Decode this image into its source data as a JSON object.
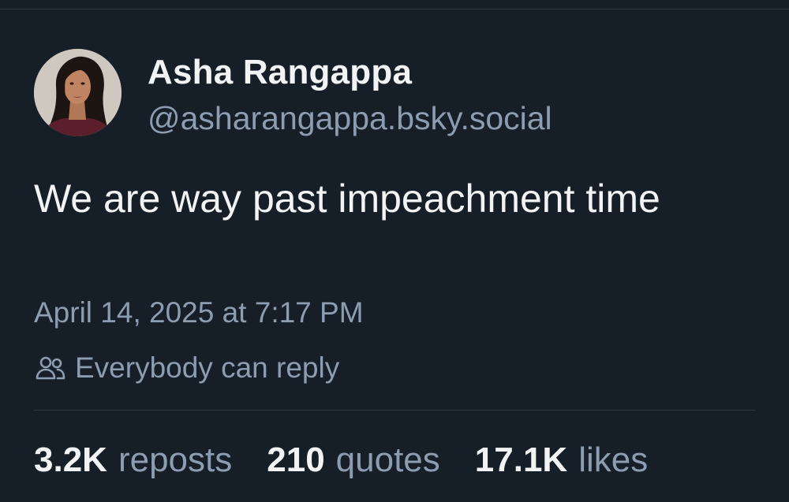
{
  "author": {
    "display_name": "Asha Rangappa",
    "handle": "@asharangappa.bsky.social",
    "avatar_icon": "profile-photo"
  },
  "post": {
    "text": "We are way past impeachment time",
    "timestamp": "April 14, 2025 at 7:17 PM",
    "reply_setting": "Everybody can reply",
    "reply_icon": "people-icon"
  },
  "stats": [
    {
      "count": "3.2K",
      "label": "reposts"
    },
    {
      "count": "210",
      "label": "quotes"
    },
    {
      "count": "17.1K",
      "label": "likes"
    }
  ],
  "colors": {
    "background": "#161e27",
    "primary_text": "#f1f3f5",
    "secondary_text": "#8d9db0",
    "divider": "#2e3a47"
  }
}
